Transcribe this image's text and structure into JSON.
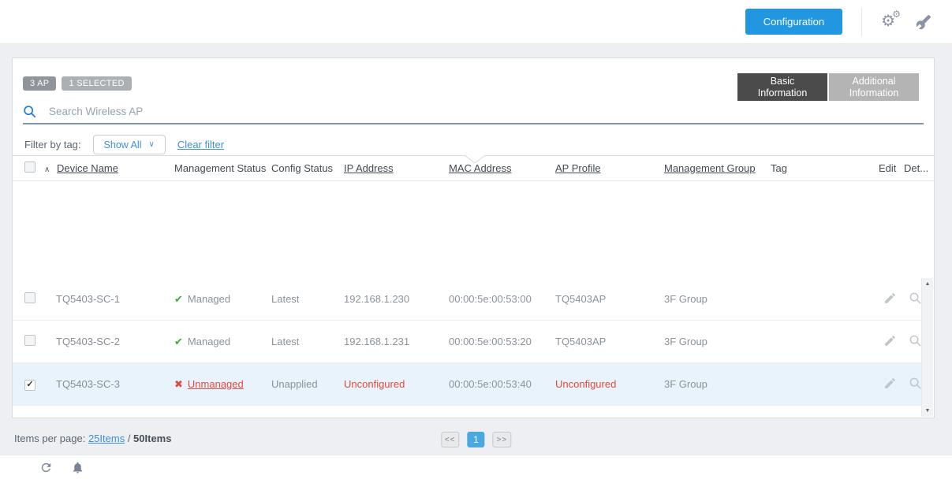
{
  "topbar": {
    "configuration_label": "Configuration"
  },
  "icons": {
    "gear": "⚙",
    "sort_asc": "∧",
    "chevron_down": "∨",
    "check": "✔",
    "cross": "✖",
    "arrow_up": "▲",
    "arrow_down": "▼",
    "checkmark": "✓"
  },
  "colors": {
    "accent_blue": "#2097e0",
    "link_blue": "#3f8fdb",
    "success_green": "#3bab3a",
    "error_red": "#e3493c",
    "selected_row": "#e9f3fb",
    "tab_active": "#4b4b4b",
    "tab_inactive": "#b4b4b4"
  },
  "panel": {
    "badges": [
      {
        "label": "3 AP"
      },
      {
        "label": "1 SELECTED"
      }
    ],
    "tabs": [
      {
        "label": "Basic Information",
        "active": true
      },
      {
        "label": "Additional Information",
        "active": false
      }
    ],
    "search_placeholder": "Search Wireless AP",
    "filter_label": "Filter by tag:",
    "filter_dropdown_value": "Show All",
    "clear_filter_label": "Clear filter"
  },
  "table": {
    "columns": [
      {
        "label": "",
        "key": "checkbox"
      },
      {
        "label": "Device Name",
        "sortable": true
      },
      {
        "label": "Management Status",
        "sortable": false
      },
      {
        "label": "Config Status",
        "sortable": false
      },
      {
        "label": "IP Address",
        "sortable": true
      },
      {
        "label": "MAC Address",
        "sortable": true
      },
      {
        "label": "AP Profile",
        "sortable": true
      },
      {
        "label": "Management Group",
        "sortable": true
      },
      {
        "label": "Tag",
        "sortable": false
      },
      {
        "label": "Edit",
        "sortable": false
      },
      {
        "label": "Det...",
        "sortable": false
      }
    ],
    "rows": [
      {
        "checked": false,
        "selected": false,
        "device_name": "TQ5403-SC-1",
        "mgmt_status": "Managed",
        "mgmt_ok": true,
        "config_status": "Latest",
        "ip": "192.168.1.230",
        "ip_error": false,
        "mac": "00:00:5e:00:53:00",
        "ap_profile": "TQ5403AP",
        "ap_profile_error": false,
        "group": "3F Group",
        "tag": ""
      },
      {
        "checked": false,
        "selected": false,
        "device_name": "TQ5403-SC-2",
        "mgmt_status": "Managed",
        "mgmt_ok": true,
        "config_status": "Latest",
        "ip": "192.168.1.231",
        "ip_error": false,
        "mac": "00:00:5e:00:53:20",
        "ap_profile": "TQ5403AP",
        "ap_profile_error": false,
        "group": "3F Group",
        "tag": ""
      },
      {
        "checked": true,
        "selected": true,
        "device_name": "TQ5403-SC-3",
        "mgmt_status": "Unmanaged",
        "mgmt_ok": false,
        "config_status": "Unapplied",
        "ip": "Unconfigured",
        "ip_error": true,
        "mac": "00:00:5e:00:53:40",
        "ap_profile": "Unconfigured",
        "ap_profile_error": true,
        "group": "3F Group",
        "tag": ""
      }
    ]
  },
  "footer": {
    "items_per_page_label": "Items per page:",
    "option_25": "25Items",
    "separator": " / ",
    "option_50": "50Items",
    "pagination": {
      "prev": "<<",
      "page": "1",
      "next": ">>"
    }
  }
}
